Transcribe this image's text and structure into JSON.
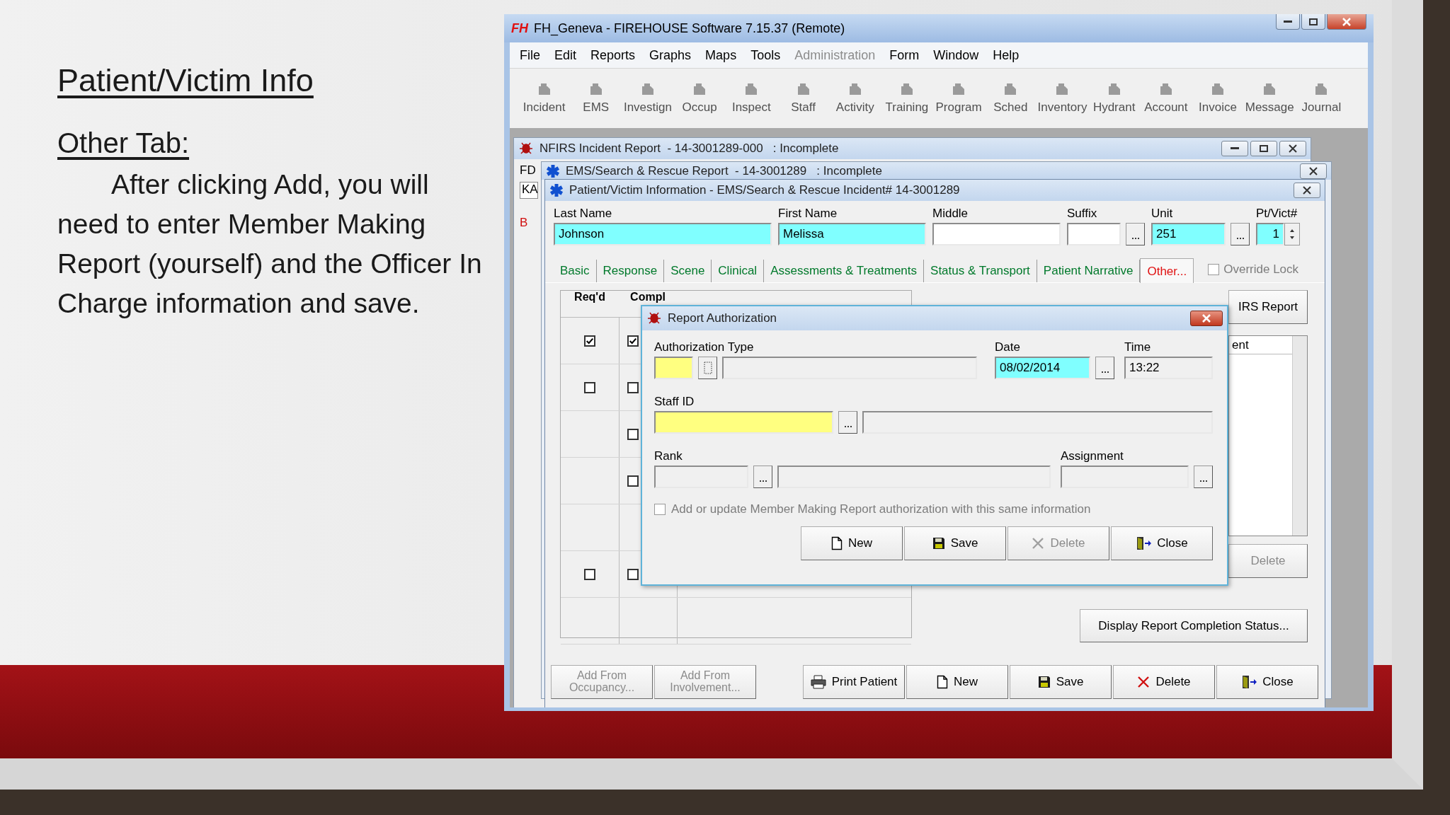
{
  "slide": {
    "title": "Patient/Victim Info",
    "subtitle": "Other Tab:",
    "body": "After clicking Add, you will need to enter Member Making Report (yourself) and the Officer In Charge information and save."
  },
  "app": {
    "logo": "FH",
    "title": "FH_Geneva - FIREHOUSE Software 7.15.37 (Remote)",
    "menu": [
      {
        "label": "File",
        "disabled": false
      },
      {
        "label": "Edit",
        "disabled": false
      },
      {
        "label": "Reports",
        "disabled": false
      },
      {
        "label": "Graphs",
        "disabled": false
      },
      {
        "label": "Maps",
        "disabled": false
      },
      {
        "label": "Tools",
        "disabled": false
      },
      {
        "label": "Administration",
        "disabled": true
      },
      {
        "label": "Form",
        "disabled": false
      },
      {
        "label": "Window",
        "disabled": false
      },
      {
        "label": "Help",
        "disabled": false
      }
    ],
    "toolbar": [
      "Incident",
      "EMS",
      "Investign",
      "Occup",
      "Inspect",
      "Staff",
      "Activity",
      "Training",
      "Program",
      "Sched",
      "Inventory",
      "Hydrant",
      "Account",
      "Invoice",
      "Message",
      "Journal"
    ]
  },
  "nfirs_window": {
    "title": "NFIRS Incident Report  - 14-3001289-000   : Incomplete",
    "label": "FD",
    "field_value": "KA",
    "tab_label": "B"
  },
  "ems_window": {
    "title": "EMS/Search & Rescue Report  - 14-3001289   : Incomplete"
  },
  "patient_window": {
    "title": "Patient/Victim Information - EMS/Search & Rescue Incident# 14-3001289",
    "fields": [
      {
        "label": "Last Name",
        "value": "Johnson",
        "color": "#80ffff",
        "kind": "text"
      },
      {
        "label": "First Name",
        "value": "Melissa",
        "color": "#80ffff",
        "kind": "text"
      },
      {
        "label": "Middle",
        "kind": "text"
      },
      {
        "label": "Suffix",
        "kind": "lookup"
      },
      {
        "label": "Unit",
        "value": "251",
        "color": "#80ffff",
        "kind": "lookup"
      },
      {
        "label": "Pt/Vict#",
        "value": "1",
        "color": "#80ffff",
        "kind": "spinner"
      }
    ],
    "tabs": [
      {
        "label": "Basic",
        "selected": false
      },
      {
        "label": "Response",
        "selected": false
      },
      {
        "label": "Scene",
        "selected": false
      },
      {
        "label": "Clinical",
        "selected": false
      },
      {
        "label": "Assessments & Treatments",
        "selected": false
      },
      {
        "label": "Status & Transport",
        "selected": false
      },
      {
        "label": "Patient Narrative",
        "selected": false
      },
      {
        "label": "Other...",
        "selected": true
      }
    ],
    "override_lock": {
      "label": "Override Lock",
      "checked": false,
      "disabled": true
    },
    "checklist": {
      "columns": [
        "Req'd",
        "Compl"
      ],
      "rows": [
        {
          "req": {
            "checked": true
          },
          "compl": {
            "checked": true
          }
        },
        {
          "req": {
            "checked": false
          },
          "compl": {
            "checked": false
          }
        },
        {
          "compl": {
            "checked": false
          }
        },
        {
          "compl": {
            "checked": false
          }
        },
        {},
        {
          "req": {
            "checked": false
          },
          "compl": {
            "checked": false
          }
        },
        {}
      ]
    },
    "report_button": "IRS Report",
    "list_header": "ent",
    "delete_button": {
      "label": "Delete",
      "disabled": true
    },
    "status_button": "Display Report Completion Status...",
    "buttons": [
      {
        "label": "Add From Occupancy...",
        "disabled": true
      },
      {
        "label": "Add From Involvement...",
        "disabled": true
      },
      {
        "label": "Print Patient",
        "kind": "printer",
        "disabled": false
      },
      {
        "label": "New",
        "kind": "page",
        "disabled": false
      },
      {
        "label": "Save",
        "kind": "floppy",
        "disabled": false
      },
      {
        "label": "Delete",
        "kind": "cross",
        "disabled": false
      },
      {
        "label": "Close",
        "kind": "door",
        "disabled": false
      }
    ]
  },
  "dialog": {
    "title": "Report Authorization",
    "authorization_type": {
      "label": "Authorization Type",
      "color": "#ffff80"
    },
    "date": {
      "label": "Date",
      "value": "08/02/2014",
      "color": "#80ffff"
    },
    "time": {
      "label": "Time",
      "value": "13:22"
    },
    "staff_id": {
      "label": "Staff ID",
      "color": "#ffff80"
    },
    "rank": {
      "label": "Rank"
    },
    "assignment": {
      "label": "Assignment"
    },
    "same_info": {
      "label": "Add or update Member Making Report authorization with this same information",
      "checked": false,
      "disabled": true
    },
    "buttons": [
      {
        "label": "New",
        "kind": "page",
        "disabled": false
      },
      {
        "label": "Save",
        "kind": "floppy",
        "disabled": false
      },
      {
        "label": "Delete",
        "kind": "cross",
        "disabled": true
      },
      {
        "label": "Close",
        "kind": "door",
        "disabled": false
      }
    ]
  }
}
